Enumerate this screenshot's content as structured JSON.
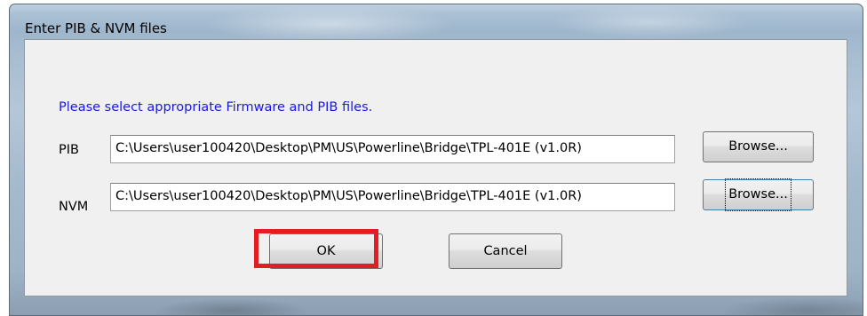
{
  "dialog": {
    "title": "Enter PIB & NVM files",
    "instruction": "Please select appropriate Firmware and PIB files.",
    "pib": {
      "label": "PIB",
      "value": "C:\\Users\\user100420\\Desktop\\PM\\US\\Powerline\\Bridge\\TPL-401E (v1.0R)",
      "browse_label": "Browse..."
    },
    "nvm": {
      "label": "NVM",
      "value": "C:\\Users\\user100420\\Desktop\\PM\\US\\Powerline\\Bridge\\TPL-401E (v1.0R)",
      "browse_label": "Browse..."
    },
    "ok_label": "OK",
    "cancel_label": "Cancel"
  },
  "colors": {
    "instruction_text": "#1a1adf",
    "highlight_box": "#e41d25",
    "dialog_face": "#f0f0f0"
  }
}
